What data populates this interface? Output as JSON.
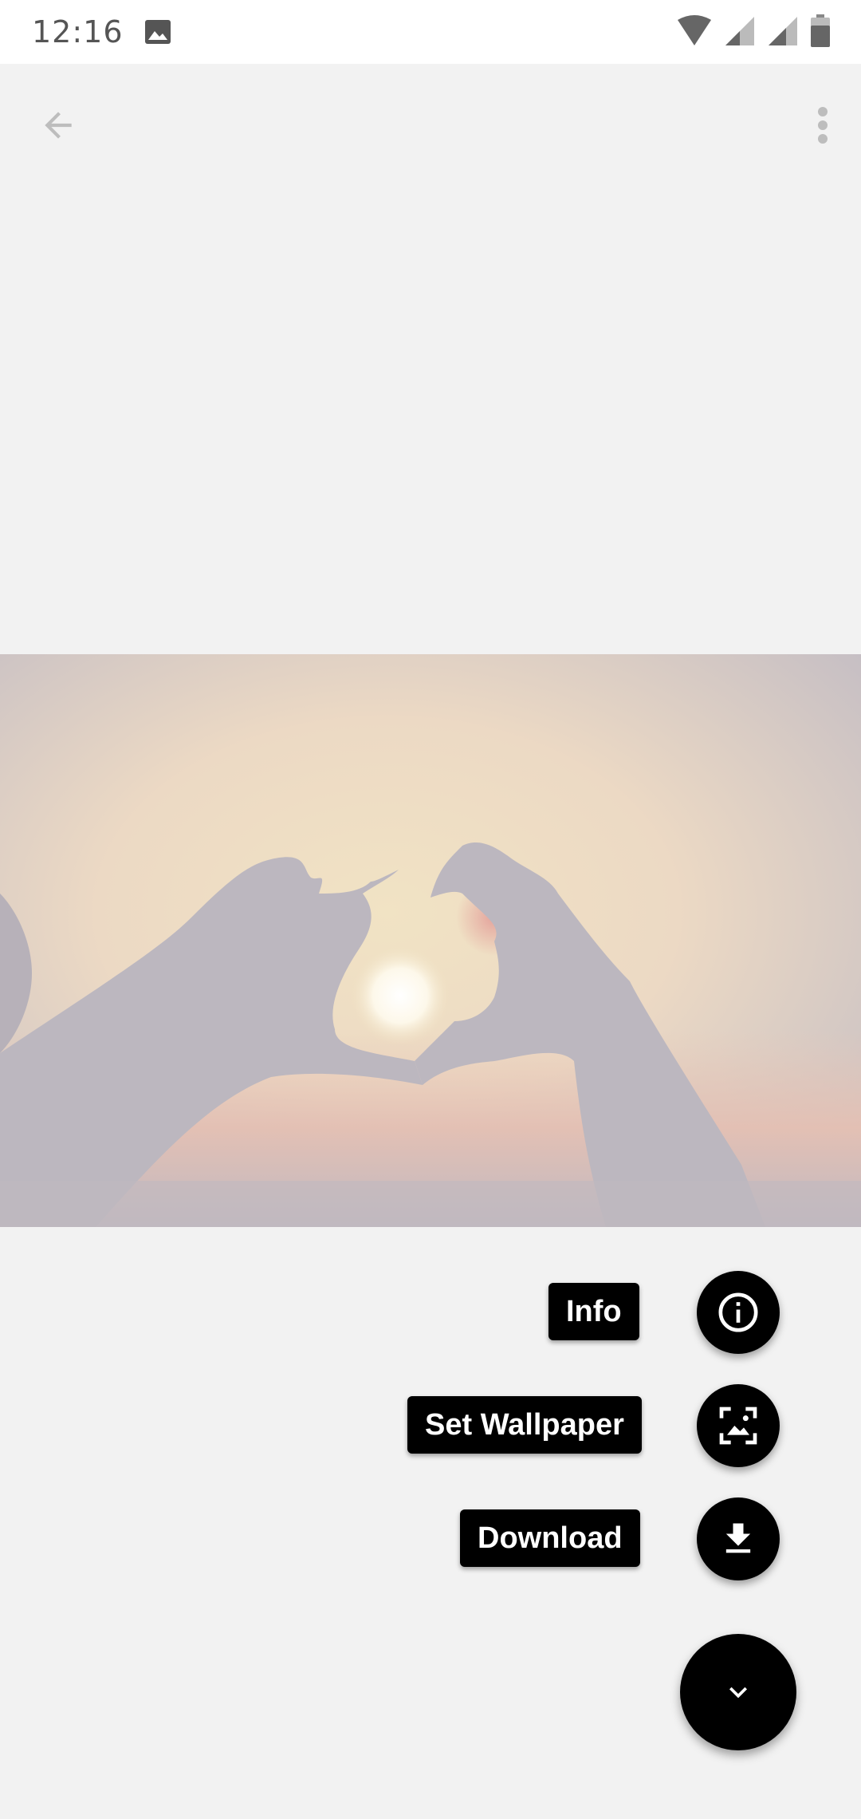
{
  "status_bar": {
    "time": "12:16",
    "icons": [
      "gallery-notification-icon",
      "wifi-icon",
      "signal-1-icon",
      "signal-2-icon",
      "battery-icon"
    ]
  },
  "toolbar": {
    "back_icon": "arrow-back-icon",
    "menu_icon": "more-vert-icon"
  },
  "wallpaper": {
    "subject": "hands-heart-sunset-image"
  },
  "speed_dial": {
    "actions": [
      {
        "label": "Info",
        "icon": "info-icon"
      },
      {
        "label": "Set Wallpaper",
        "icon": "wallpaper-icon"
      },
      {
        "label": "Download",
        "icon": "download-icon"
      }
    ],
    "toggle_icon": "chevron-down-icon"
  },
  "colors": {
    "background": "#f2f2f2",
    "fab": "#000000",
    "label_bg": "#000000",
    "label_text": "#ffffff"
  }
}
